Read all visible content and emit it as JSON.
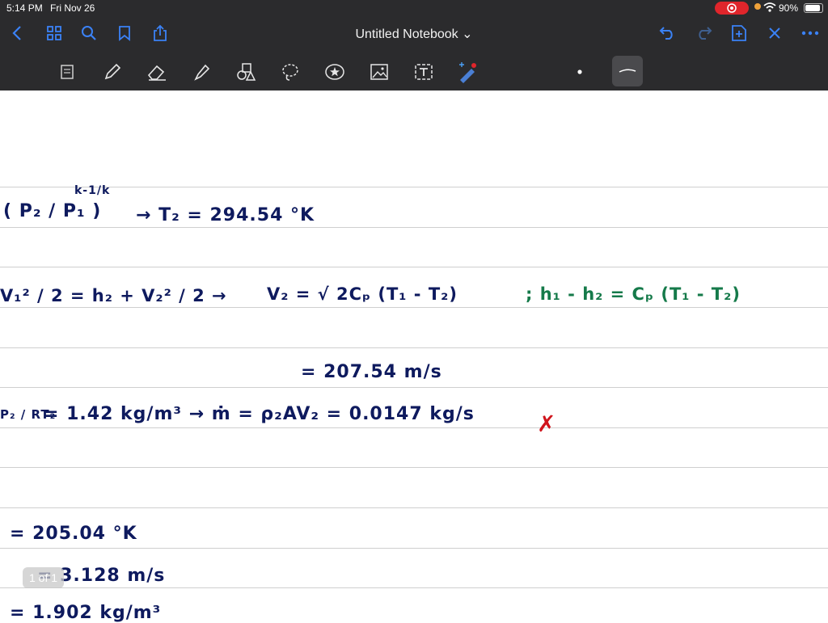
{
  "status": {
    "time": "5:14 PM",
    "date": "Fri Nov 26",
    "battery": "90%"
  },
  "nav": {
    "title": "Untitled Notebook ⌄"
  },
  "toolbar": {
    "tools": [
      "reader-icon",
      "pen-icon",
      "eraser-icon",
      "highlighter-icon",
      "shapes-icon",
      "lasso-icon",
      "sticker-icon",
      "image-icon",
      "text-icon",
      "laser-pointer-icon"
    ],
    "selected": "stroke-width-thin"
  },
  "notes": {
    "l1_ratio": "( P₂ / P₁ )",
    "l1_exp": "k-1/k",
    "l1_result": "→   T₂ = 294.54 °K",
    "l2_eq": "V₁² / 2  =  h₂  +  V₂² / 2  →",
    "l2_result": "V₂ = √ 2Cₚ (T₁ - T₂)",
    "l2_note": ";   h₁ - h₂ = Cₚ (T₁ - T₂)",
    "l3": "= 207.54 m/s",
    "l4_left": "P₂ / RT₂",
    "l4": "= 1.42 kg/m³  →   ṁ = ρ₂AV₂ = 0.0147 kg/s",
    "l4_mark": "✗",
    "l5": "= 205.04 °K",
    "l6": "= 3.128  m/s",
    "l7": "= 1.902  kg/m³"
  },
  "pager": {
    "label": "1 of 1"
  }
}
